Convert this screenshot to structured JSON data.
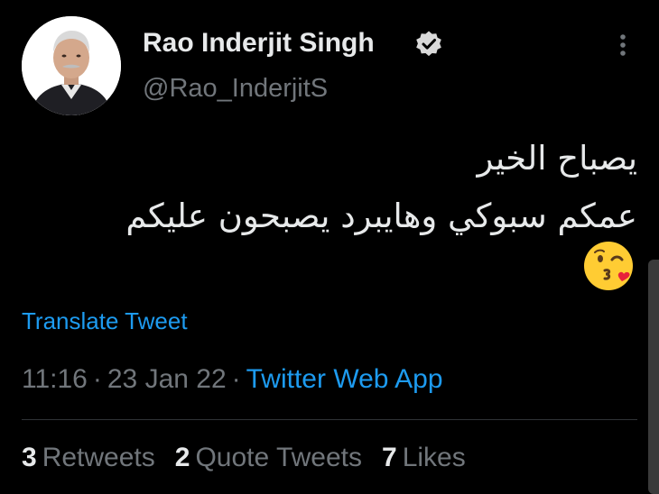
{
  "author": {
    "display_name": "Rao Inderjit Singh",
    "handle": "@Rao_InderjitS",
    "verified": true
  },
  "icons": {
    "verified": "verified-badge-icon",
    "more": "more-dots-icon",
    "emoji": "face-blowing-kiss-emoji"
  },
  "tweet": {
    "lines": [
      "يصباح الخير",
      "عمكم سبوكي وهايبرد يصبحون عليكم"
    ],
    "translate_label": "Translate Tweet",
    "time": "11:16",
    "date": "23 Jan 22",
    "source": "Twitter Web App"
  },
  "stats": {
    "retweets_count": "3",
    "retweets_label": "Retweets",
    "quotes_count": "2",
    "quotes_label": "Quote Tweets",
    "likes_count": "7",
    "likes_label": "Likes"
  },
  "colors": {
    "background": "#000000",
    "primary_text": "#e7e9ea",
    "secondary_text": "#71767b",
    "link": "#1d9bf0",
    "divider": "#2f3336"
  }
}
